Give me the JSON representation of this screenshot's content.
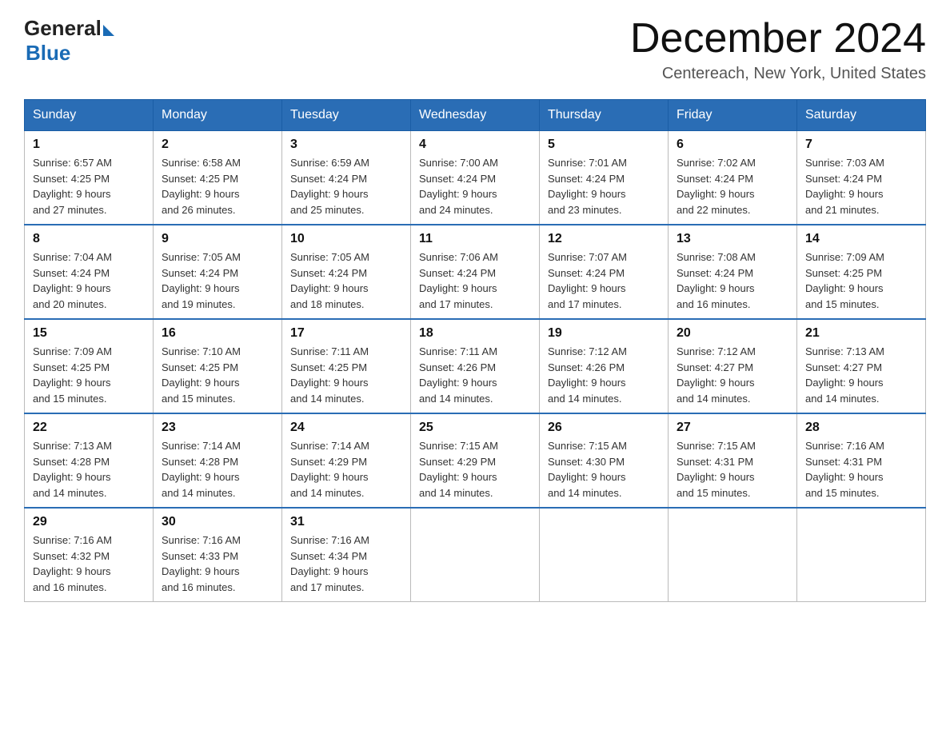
{
  "header": {
    "logo": {
      "general": "General",
      "blue": "Blue",
      "subtitle": "Blue"
    },
    "title": "December 2024",
    "location": "Centereach, New York, United States"
  },
  "weekdays": [
    "Sunday",
    "Monday",
    "Tuesday",
    "Wednesday",
    "Thursday",
    "Friday",
    "Saturday"
  ],
  "weeks": [
    [
      {
        "day": "1",
        "sunrise": "6:57 AM",
        "sunset": "4:25 PM",
        "daylight": "9 hours and 27 minutes."
      },
      {
        "day": "2",
        "sunrise": "6:58 AM",
        "sunset": "4:25 PM",
        "daylight": "9 hours and 26 minutes."
      },
      {
        "day": "3",
        "sunrise": "6:59 AM",
        "sunset": "4:24 PM",
        "daylight": "9 hours and 25 minutes."
      },
      {
        "day": "4",
        "sunrise": "7:00 AM",
        "sunset": "4:24 PM",
        "daylight": "9 hours and 24 minutes."
      },
      {
        "day": "5",
        "sunrise": "7:01 AM",
        "sunset": "4:24 PM",
        "daylight": "9 hours and 23 minutes."
      },
      {
        "day": "6",
        "sunrise": "7:02 AM",
        "sunset": "4:24 PM",
        "daylight": "9 hours and 22 minutes."
      },
      {
        "day": "7",
        "sunrise": "7:03 AM",
        "sunset": "4:24 PM",
        "daylight": "9 hours and 21 minutes."
      }
    ],
    [
      {
        "day": "8",
        "sunrise": "7:04 AM",
        "sunset": "4:24 PM",
        "daylight": "9 hours and 20 minutes."
      },
      {
        "day": "9",
        "sunrise": "7:05 AM",
        "sunset": "4:24 PM",
        "daylight": "9 hours and 19 minutes."
      },
      {
        "day": "10",
        "sunrise": "7:05 AM",
        "sunset": "4:24 PM",
        "daylight": "9 hours and 18 minutes."
      },
      {
        "day": "11",
        "sunrise": "7:06 AM",
        "sunset": "4:24 PM",
        "daylight": "9 hours and 17 minutes."
      },
      {
        "day": "12",
        "sunrise": "7:07 AM",
        "sunset": "4:24 PM",
        "daylight": "9 hours and 17 minutes."
      },
      {
        "day": "13",
        "sunrise": "7:08 AM",
        "sunset": "4:24 PM",
        "daylight": "9 hours and 16 minutes."
      },
      {
        "day": "14",
        "sunrise": "7:09 AM",
        "sunset": "4:25 PM",
        "daylight": "9 hours and 15 minutes."
      }
    ],
    [
      {
        "day": "15",
        "sunrise": "7:09 AM",
        "sunset": "4:25 PM",
        "daylight": "9 hours and 15 minutes."
      },
      {
        "day": "16",
        "sunrise": "7:10 AM",
        "sunset": "4:25 PM",
        "daylight": "9 hours and 15 minutes."
      },
      {
        "day": "17",
        "sunrise": "7:11 AM",
        "sunset": "4:25 PM",
        "daylight": "9 hours and 14 minutes."
      },
      {
        "day": "18",
        "sunrise": "7:11 AM",
        "sunset": "4:26 PM",
        "daylight": "9 hours and 14 minutes."
      },
      {
        "day": "19",
        "sunrise": "7:12 AM",
        "sunset": "4:26 PM",
        "daylight": "9 hours and 14 minutes."
      },
      {
        "day": "20",
        "sunrise": "7:12 AM",
        "sunset": "4:27 PM",
        "daylight": "9 hours and 14 minutes."
      },
      {
        "day": "21",
        "sunrise": "7:13 AM",
        "sunset": "4:27 PM",
        "daylight": "9 hours and 14 minutes."
      }
    ],
    [
      {
        "day": "22",
        "sunrise": "7:13 AM",
        "sunset": "4:28 PM",
        "daylight": "9 hours and 14 minutes."
      },
      {
        "day": "23",
        "sunrise": "7:14 AM",
        "sunset": "4:28 PM",
        "daylight": "9 hours and 14 minutes."
      },
      {
        "day": "24",
        "sunrise": "7:14 AM",
        "sunset": "4:29 PM",
        "daylight": "9 hours and 14 minutes."
      },
      {
        "day": "25",
        "sunrise": "7:15 AM",
        "sunset": "4:29 PM",
        "daylight": "9 hours and 14 minutes."
      },
      {
        "day": "26",
        "sunrise": "7:15 AM",
        "sunset": "4:30 PM",
        "daylight": "9 hours and 14 minutes."
      },
      {
        "day": "27",
        "sunrise": "7:15 AM",
        "sunset": "4:31 PM",
        "daylight": "9 hours and 15 minutes."
      },
      {
        "day": "28",
        "sunrise": "7:16 AM",
        "sunset": "4:31 PM",
        "daylight": "9 hours and 15 minutes."
      }
    ],
    [
      {
        "day": "29",
        "sunrise": "7:16 AM",
        "sunset": "4:32 PM",
        "daylight": "9 hours and 16 minutes."
      },
      {
        "day": "30",
        "sunrise": "7:16 AM",
        "sunset": "4:33 PM",
        "daylight": "9 hours and 16 minutes."
      },
      {
        "day": "31",
        "sunrise": "7:16 AM",
        "sunset": "4:34 PM",
        "daylight": "9 hours and 17 minutes."
      },
      null,
      null,
      null,
      null
    ]
  ],
  "labels": {
    "sunrise": "Sunrise:",
    "sunset": "Sunset:",
    "daylight": "Daylight:"
  }
}
